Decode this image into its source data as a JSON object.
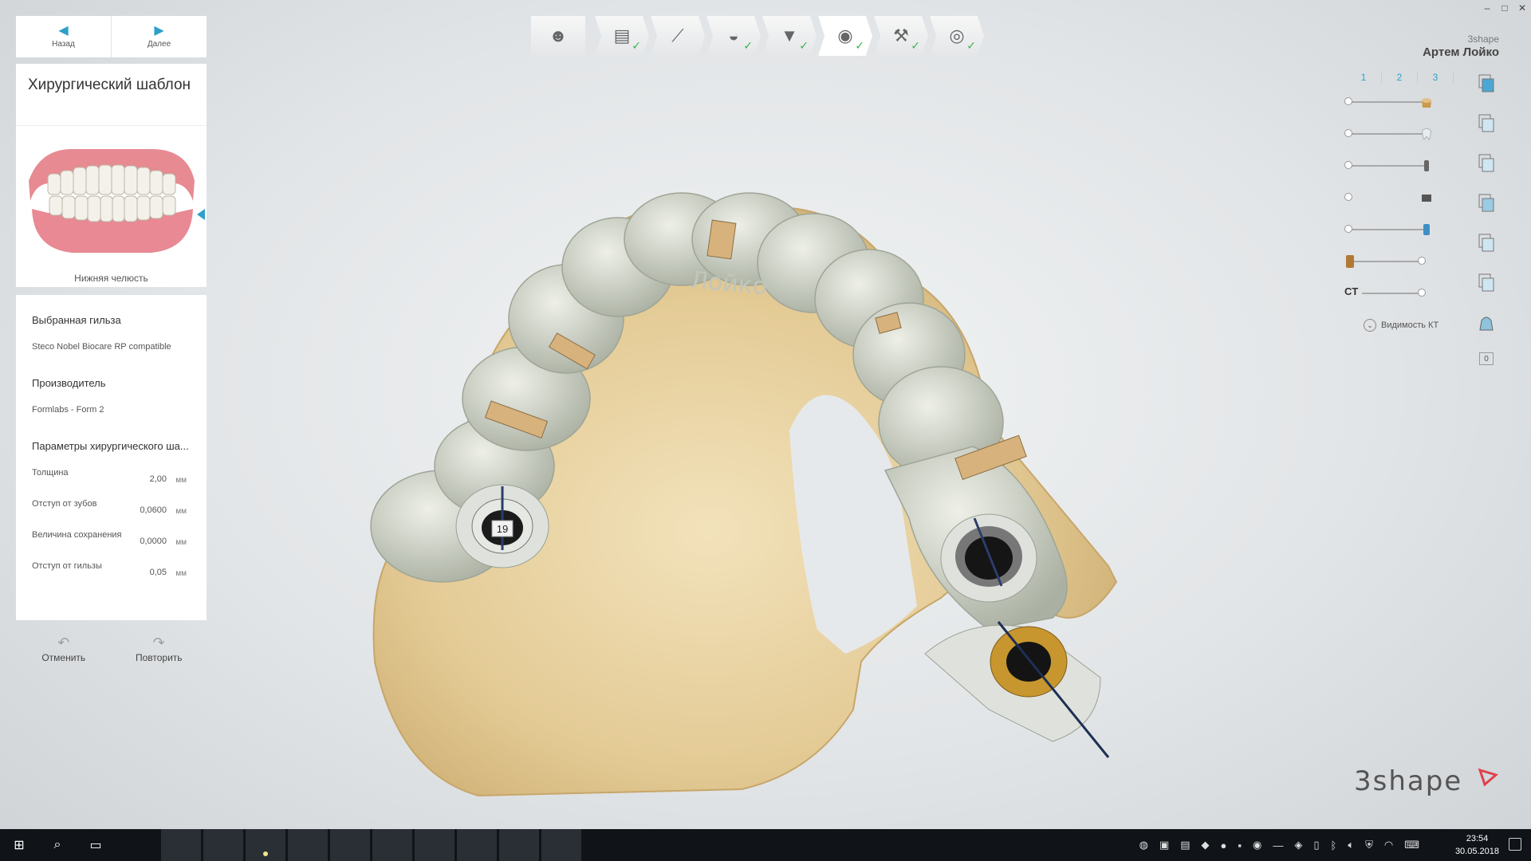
{
  "window": {
    "min": "–",
    "max": "□",
    "close": "✕"
  },
  "nav": {
    "back_label": "Назад",
    "next_label": "Далее"
  },
  "title_panel": {
    "title": "Хирургический шаблон",
    "jaw_caption": "Нижняя челюсть"
  },
  "params": {
    "sleeve_heading": "Выбранная гильза",
    "sleeve_value": "Steco Nobel Biocare RP compatible",
    "manufacturer_heading": "Производитель",
    "manufacturer_value": "Formlabs - Form 2",
    "template_heading": "Параметры хирургического ша...",
    "rows": [
      {
        "label": "Толщина",
        "value": "2,00",
        "unit": "мм"
      },
      {
        "label": "Отступ от зубов",
        "value": "0,0600",
        "unit": "мм"
      },
      {
        "label": "Величина сохранения",
        "value": "0,0000",
        "unit": "мм"
      },
      {
        "label": "Отступ от гильзы",
        "value": "0,05",
        "unit": "мм"
      }
    ]
  },
  "history": {
    "undo_label": "Отменить",
    "redo_label": "Повторить"
  },
  "workflow": {
    "steps": [
      {
        "icon": "patient-icon",
        "done": false
      },
      {
        "icon": "order-form-icon",
        "done": true
      },
      {
        "icon": "implant-icon",
        "done": true
      },
      {
        "icon": "scan-icon",
        "done": true
      },
      {
        "icon": "sleeve-icon",
        "done": true
      },
      {
        "icon": "eye-view-icon",
        "done": true,
        "active": true
      },
      {
        "icon": "guide-icon",
        "done": true
      },
      {
        "icon": "disc-export-icon",
        "done": true
      }
    ]
  },
  "user": {
    "brand": "3shape",
    "name": "Артем Лойко"
  },
  "visibility": {
    "tabs": [
      "1",
      "2",
      "3"
    ],
    "ct_label": "CT",
    "ct_toggle_label": "Видимость КТ",
    "copy_icon_badge": "0"
  },
  "viewport": {
    "implant_number": "19",
    "engraving": "Лойко"
  },
  "logo": {
    "text": "3shape"
  },
  "taskbar": {
    "time": "23:54",
    "date": "30.05.2018"
  },
  "colors": {
    "accent": "#2ea0c9",
    "check": "#3bb54a",
    "guide": "#d5d9cc",
    "model": "#e7d2a8",
    "sleeve": "#c8962e"
  }
}
